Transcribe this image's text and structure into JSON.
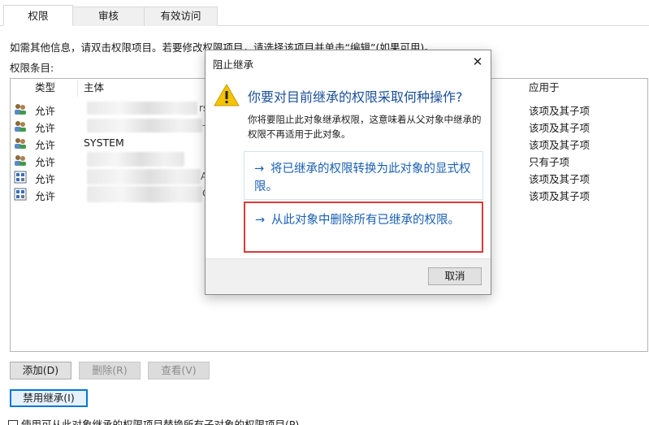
{
  "tabs": [
    {
      "label": "权限",
      "active": true
    },
    {
      "label": "审核",
      "active": false
    },
    {
      "label": "有效访问",
      "active": false
    }
  ],
  "hint": "如需其他信息，请双击权限项目。若要修改权限项目，请选择该项目并单击“编辑”(如果可用)。",
  "entries_label": "权限条目:",
  "columns": {
    "type": "类型",
    "principal": "主体",
    "applies_to": "应用于"
  },
  "rows": [
    {
      "icon": "users-icon",
      "type": "允许",
      "principal": "",
      "applies_to": "该项及其子项"
    },
    {
      "icon": "users-icon",
      "type": "允许",
      "principal": "",
      "applies_to": "该项及其子项"
    },
    {
      "icon": "users-icon",
      "type": "允许",
      "principal": "SYSTEM",
      "applies_to": "该项及其子项"
    },
    {
      "icon": "users-icon",
      "type": "允许",
      "principal": "",
      "applies_to": "只有子项"
    },
    {
      "icon": "network-group-icon",
      "type": "允许",
      "principal": "",
      "applies_to": "该项及其子项"
    },
    {
      "icon": "network-group-icon",
      "type": "允许",
      "principal": "",
      "applies_to": "该项及其子项"
    }
  ],
  "fragments": [
    "rs",
    "-F",
    "AC",
    "C"
  ],
  "buttons": {
    "add": "添加(D)",
    "remove": "删除(R)",
    "view": "查看(V)",
    "disable_inheritance": "禁用继承(I)"
  },
  "checkbox_label": "使用可从此对象继承的权限项目替换所有子对象的权限项目(P)",
  "dialog": {
    "title": "阻止继承",
    "close": "✕",
    "heading": "你要对目前继承的权限采取何种操作?",
    "message": "你将要阻止此对象继承权限，这意味着从父对象中继承的权限不再适用于此对象。",
    "option1": "将已继承的权限转换为此对象的显式权限。",
    "option2": "从此对象中删除所有已继承的权限。",
    "arrow": "→",
    "cancel": "取消"
  },
  "colors": {
    "accent": "#1a5fb4",
    "highlight": "#d93a3a",
    "warning": "#f5c400"
  }
}
